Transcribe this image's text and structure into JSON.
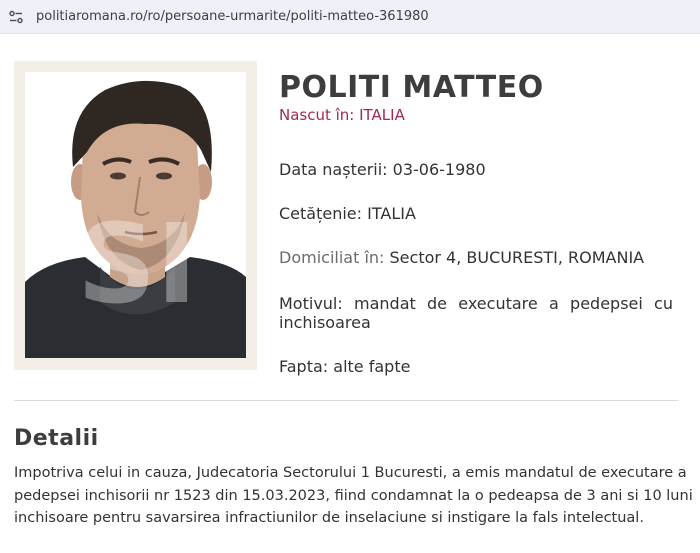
{
  "browser": {
    "url": "politiaromana.ro/ro/persoane-urmarite/politi-matteo-361980",
    "site_icon": "site-settings-icon"
  },
  "profile": {
    "name": "POLITI MATTEO",
    "born": "Nascut în: ITALIA",
    "birth_date_label": "Data nașterii:",
    "birth_date_value": "03-06-1980",
    "citizenship_label": "Cetățenie:",
    "citizenship_value": "ITALIA",
    "domicile_label": "Domiciliat în:",
    "domicile_value": "Sector 4, BUCURESTI, ROMANIA",
    "motive_label": "Motivul:",
    "motive_line1_rest": "mandat de executare a pedepsei cu",
    "motive_line2": "inchisoarea",
    "deed_label": "Fapta:",
    "deed_value": "alte fapte",
    "photo_watermark": "SI"
  },
  "details": {
    "title": "Detalii",
    "lines": [
      "Impotriva celui in cauza, Judecatoria Sectorului 1 Bucuresti, a emis mandatul de executare a",
      "pedepsei inchisorii nr 1523 din 15.03.2023, fiind condamnat la o pedeapsa de 3 ani si 10 luni",
      "inchisoare pentru savarsirea infractiunilor de inselaciune si instigare la fals intelectual."
    ]
  }
}
